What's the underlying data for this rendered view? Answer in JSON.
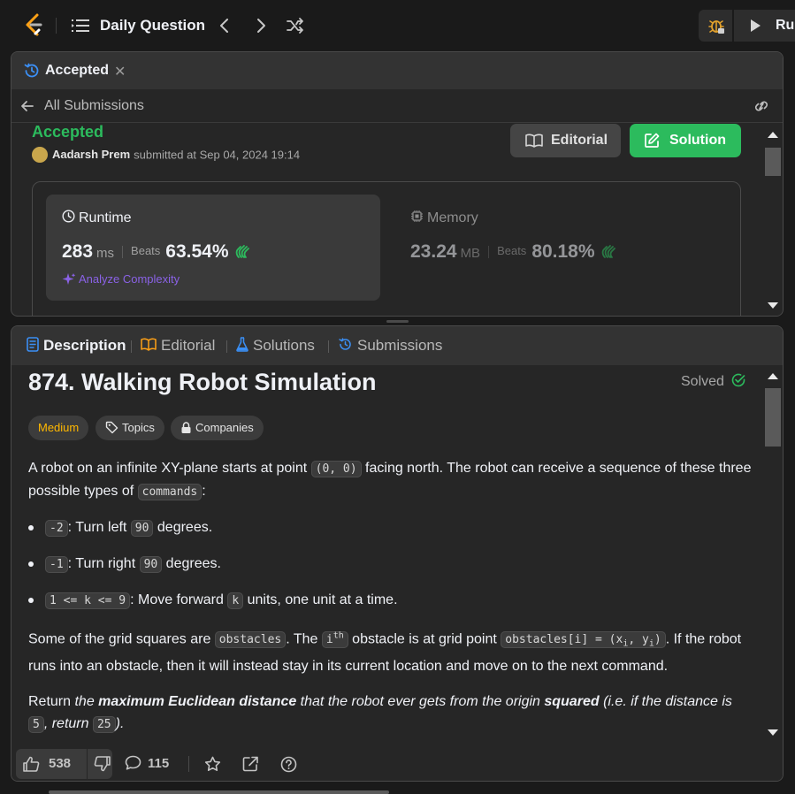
{
  "topbar": {
    "title": "Daily Question",
    "run_label": "Run"
  },
  "submission_panel": {
    "tab_label": "Accepted",
    "back_label": "All Submissions",
    "status": "Accepted",
    "username": "Aadarsh Prem",
    "submitted_text": "submitted at Sep 04, 2024 19:14",
    "editorial_label": "Editorial",
    "solution_label": "Solution",
    "runtime": {
      "title": "Runtime",
      "value": "283",
      "unit": "ms",
      "beats_label": "Beats",
      "beats_pct": "63.54%",
      "analyze_label": "Analyze Complexity"
    },
    "memory": {
      "title": "Memory",
      "value": "23.24",
      "unit": "MB",
      "beats_label": "Beats",
      "beats_pct": "80.18%"
    }
  },
  "problem_panel": {
    "tabs": [
      "Description",
      "Editorial",
      "Solutions",
      "Submissions"
    ],
    "title": "874. Walking Robot Simulation",
    "solved_label": "Solved",
    "chips": {
      "difficulty": "Medium",
      "topics": "Topics",
      "companies": "Companies"
    },
    "description": {
      "p1_a": "A robot on an infinite XY-plane starts at point ",
      "p1_code1": "(0, 0)",
      "p1_b": " facing north. The robot can receive a sequence of these three possible types of ",
      "p1_code2": "commands",
      "p1_c": ":",
      "bullet1_code": "-2",
      "bullet1_a": ": Turn left ",
      "bullet1_code2": "90",
      "bullet1_b": " degrees.",
      "bullet2_code": "-1",
      "bullet2_a": ": Turn right ",
      "bullet2_code2": "90",
      "bullet2_b": " degrees.",
      "bullet3_code": "1 <= k <= 9",
      "bullet3_a": ": Move forward ",
      "bullet3_code2": "k",
      "bullet3_b": " units, one unit at a time.",
      "p2_a": "Some of the grid squares are ",
      "p2_code1": "obstacles",
      "p2_b": ". The ",
      "p2_i": "i",
      "p2_th": "th",
      "p2_c": " obstacle is at grid point ",
      "p2_code2a": "obstacles[i] = (x",
      "p2_sub1": "i",
      "p2_code2b": ", y",
      "p2_sub2": "i",
      "p2_code2c": ")",
      "p2_d": ". If the robot runs into an obstacle, then it will instead stay in its current location and move on to the next command.",
      "p3_a": "Return ",
      "p3_b": "the ",
      "p3_c": "maximum Euclidean distance",
      "p3_d": " that the robot ever gets from the origin ",
      "p3_e": "squared",
      "p3_f": " (i.e. if the distance is ",
      "p3_code1": "5",
      "p3_g": ", return ",
      "p3_code2": "25",
      "p3_h": ")."
    },
    "footer": {
      "likes": "538",
      "comments": "115"
    }
  }
}
